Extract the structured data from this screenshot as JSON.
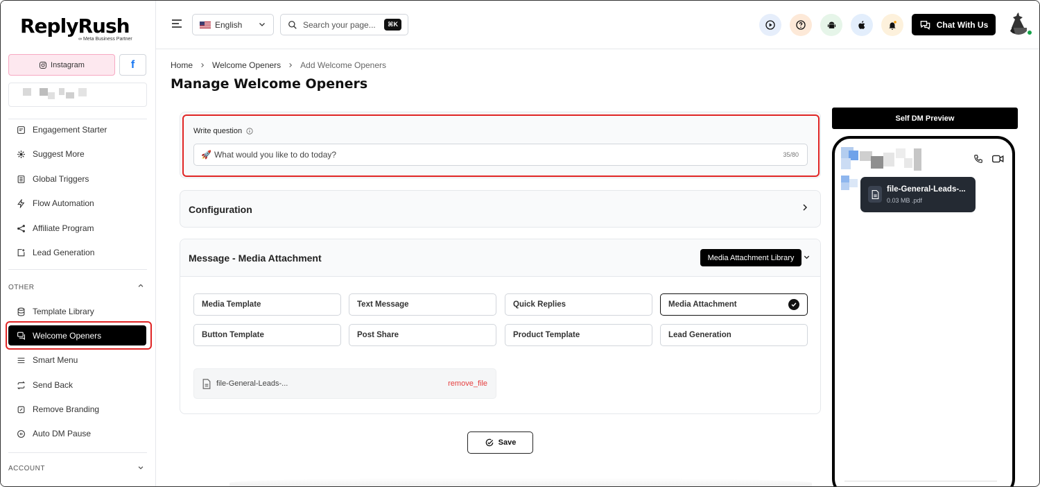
{
  "brand": {
    "name": "ReplyRush",
    "tagline": "Meta Business Partner"
  },
  "social": {
    "instagram_label": "Instagram",
    "facebook_glyph": "f"
  },
  "sidebar": {
    "items": [
      {
        "label": "Engagement Starter",
        "icon": "engagement-icon"
      },
      {
        "label": "Suggest More",
        "icon": "gear-icon"
      },
      {
        "label": "Global Triggers",
        "icon": "list-icon"
      },
      {
        "label": "Flow Automation",
        "icon": "lightning-icon"
      },
      {
        "label": "Affiliate Program",
        "icon": "share-icon"
      },
      {
        "label": "Lead Generation",
        "icon": "lead-icon"
      }
    ],
    "other_label": "OTHER",
    "other_items": [
      {
        "label": "Template Library",
        "icon": "database-icon"
      },
      {
        "label": "Welcome Openers",
        "icon": "chat-icon",
        "active": true
      },
      {
        "label": "Smart Menu",
        "icon": "menu-icon"
      },
      {
        "label": "Send Back",
        "icon": "repeat-icon"
      },
      {
        "label": "Remove Branding",
        "icon": "brush-icon"
      },
      {
        "label": "Auto DM Pause",
        "icon": "pause-icon"
      }
    ],
    "account_label": "ACCOUNT"
  },
  "topbar": {
    "language": "English",
    "search_placeholder": "Search your page...",
    "shortcut": "⌘K",
    "chat_button": "Chat With Us",
    "icons": [
      "play-icon",
      "help-icon",
      "android-icon",
      "apple-icon",
      "bell-icon"
    ]
  },
  "breadcrumb": {
    "home": "Home",
    "parent": "Welcome Openers",
    "current": "Add Welcome Openers"
  },
  "page_title": "Manage Welcome Openers",
  "question": {
    "label": "Write question",
    "emoji": "🚀",
    "value": "What would you like to do today?",
    "counter": "35/80"
  },
  "configuration": {
    "title": "Configuration"
  },
  "message": {
    "title": "Message - Media Attachment",
    "library_button": "Media Attachment Library",
    "options": [
      "Media Template",
      "Text Message",
      "Quick Replies",
      "Media Attachment",
      "Button Template",
      "Post Share",
      "Product Template",
      "Lead Generation"
    ],
    "selected_option": "Media Attachment",
    "file_name": "file-General-Leads-...",
    "remove_label": "remove_file"
  },
  "save_label": "Save",
  "preview": {
    "header": "Self DM Preview",
    "file_name": "file-General-Leads-...",
    "file_meta": "0.03 MB .pdf"
  },
  "colors": {
    "accent": "#000000",
    "highlight": "#e02424",
    "instagram_bg": "#fde8ef",
    "facebook": "#1877f2",
    "danger": "#e53e3e"
  }
}
